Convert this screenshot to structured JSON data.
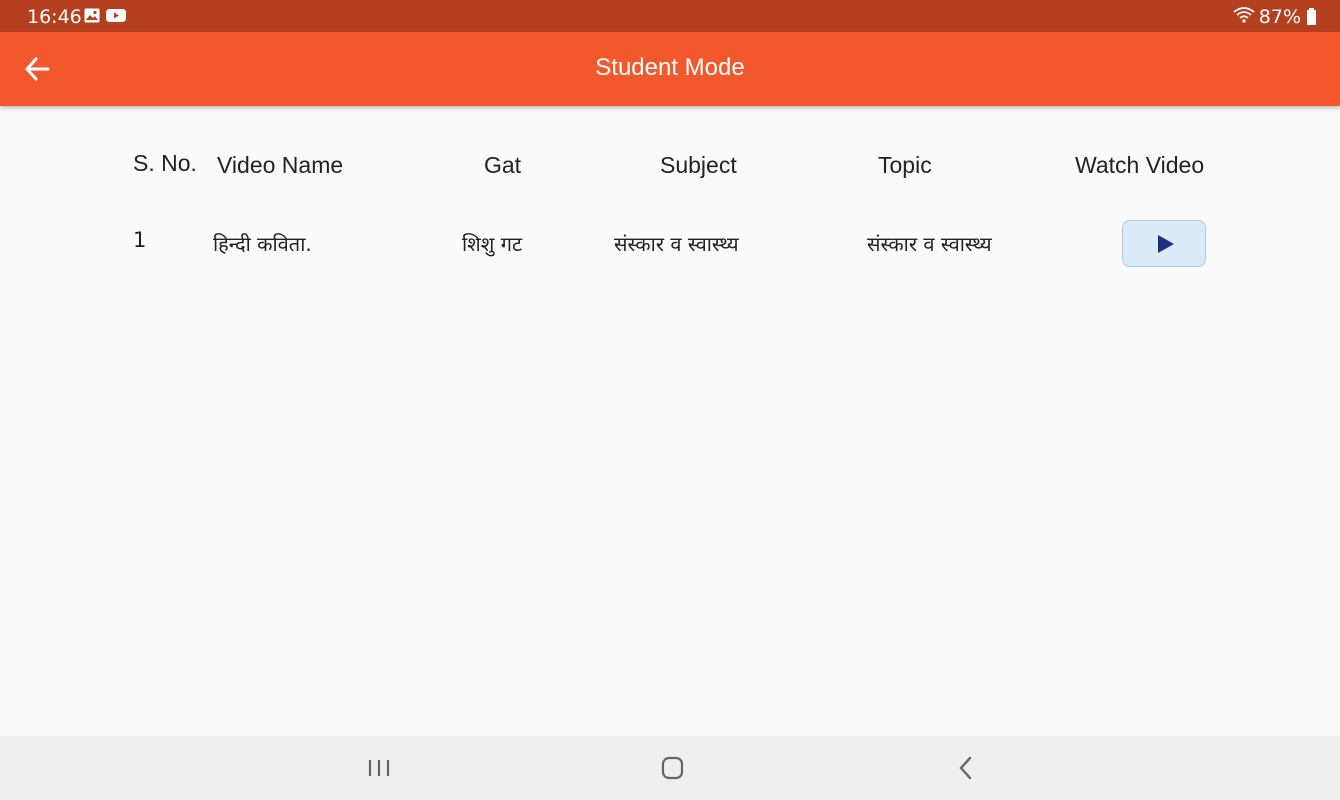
{
  "status_bar": {
    "time": "16:46",
    "battery_text": "87%",
    "icons": [
      "image-icon",
      "youtube-icon",
      "wifi-icon",
      "battery-icon"
    ]
  },
  "app_bar": {
    "title": "Student Mode",
    "back_icon": "arrow-left-icon"
  },
  "table": {
    "headers": [
      "S. No.",
      "Video Name",
      "Gat",
      "Subject",
      "Topic",
      "Watch Video"
    ],
    "rows": [
      {
        "sno": "1",
        "video_name": "हिन्दी कविता.",
        "gat": "शिशु गट",
        "subject": "संस्कार व स्वास्थ्य",
        "topic": "संस्कार व स्वास्थ्य",
        "action_icon": "play-icon"
      }
    ]
  },
  "nav_bar": {
    "icons": [
      "recent-apps-icon",
      "home-icon",
      "back-icon"
    ]
  },
  "colors": {
    "status_bar": "#b5401f",
    "app_bar": "#f2582c",
    "play_button_bg": "#dcebf9",
    "play_icon": "#1e2f86"
  }
}
